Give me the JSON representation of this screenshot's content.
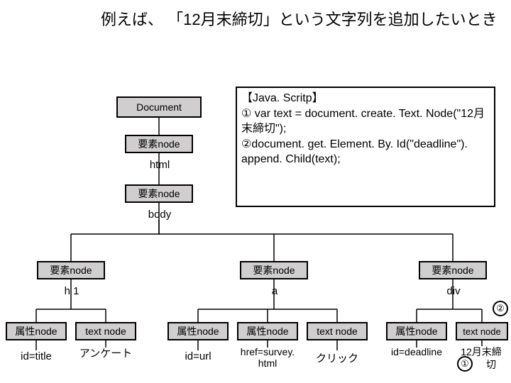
{
  "title": "例えば、 「12月末締切」という文字列を追加したいとき",
  "tree": {
    "box_document": "Document",
    "box_elem1": "要素node",
    "lbl_html": "html",
    "box_elem2": "要素node",
    "lbl_body": "body",
    "box_elem_h1": "要素node",
    "lbl_h1": "h 1",
    "box_elem_a": "要素node",
    "lbl_a": "a",
    "box_elem_div": "要素node",
    "lbl_div": "div",
    "attr1": "属性node",
    "attr1_v": "id=title",
    "tnode1": "text node",
    "tnode1_v": "アンケート",
    "attr2": "属性node",
    "attr2_v": "id=url",
    "attr3": "属性node",
    "attr3_v": "href=survey. html",
    "tnode2": "text node",
    "tnode2_v": "クリック",
    "attr4": "属性node",
    "attr4_v": "id=deadline",
    "tnode3": "text node",
    "tnode3_v_l1": "12月末締",
    "tnode3_v_l2": "切"
  },
  "jsbox": "【Java. Scritp】\n① var text = document. create. Text. Node(\"12月末締切\");\n②document. get. Element. By. Id(\"deadline\"). append. Child(text);",
  "circle2": "②",
  "circle1": "①"
}
